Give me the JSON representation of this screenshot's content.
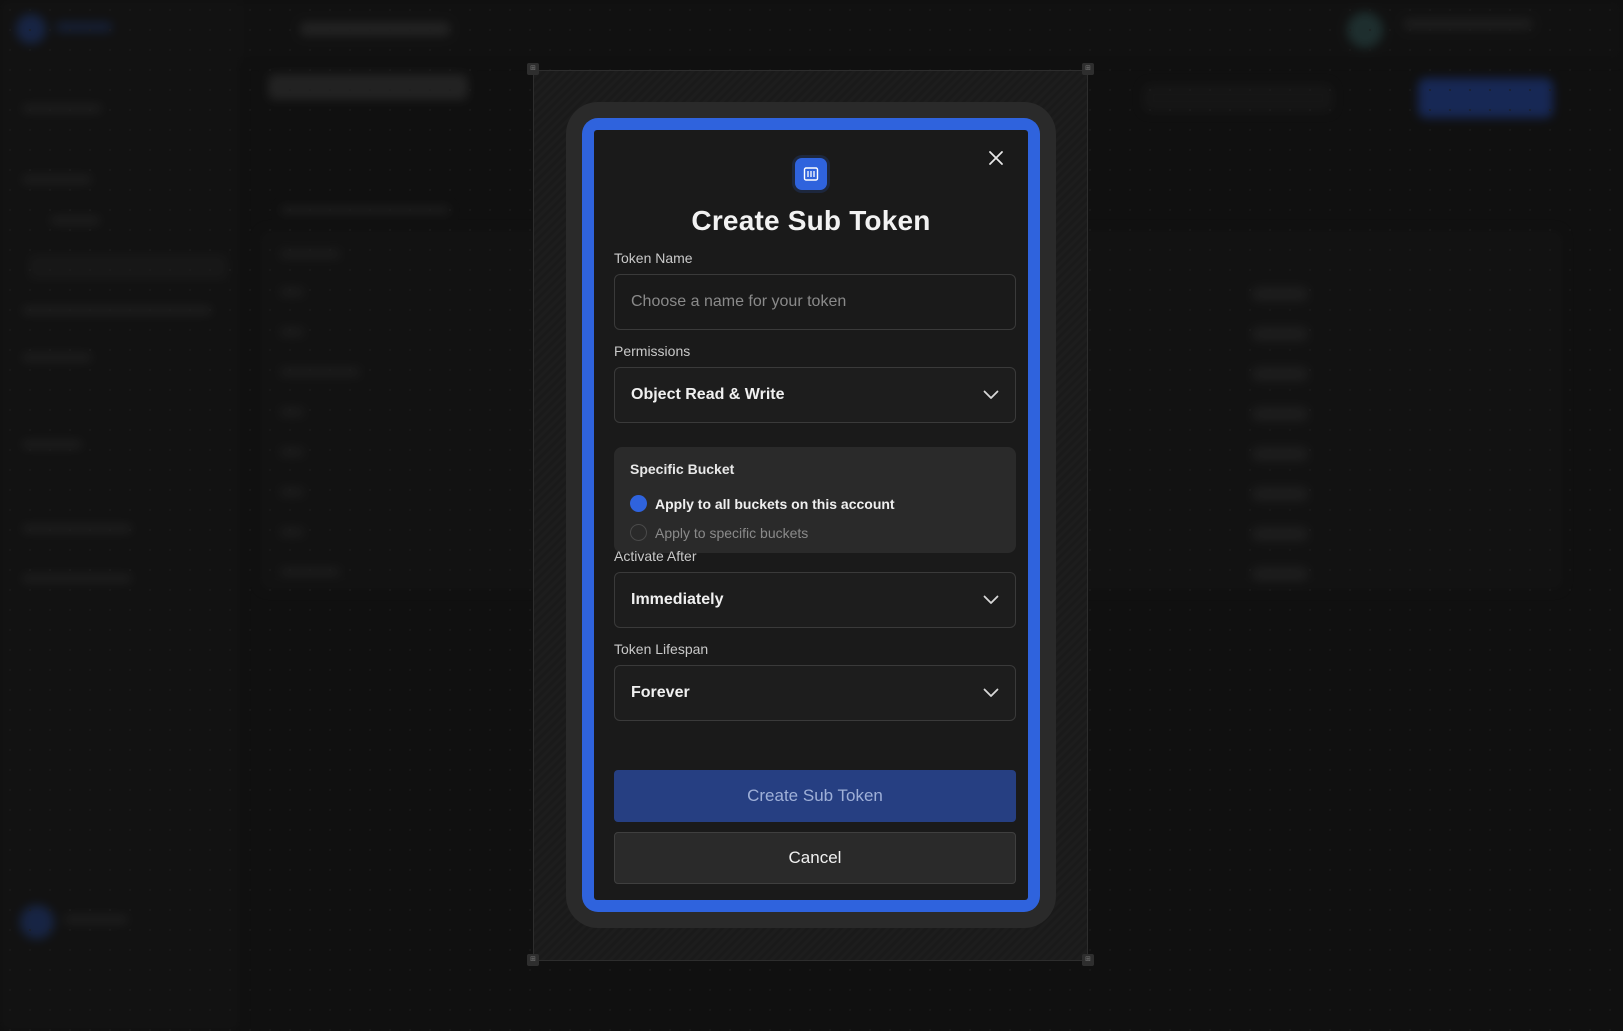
{
  "modal": {
    "title": "Create Sub Token",
    "app_icon": "bucket-grid-icon",
    "close_icon": "close-icon"
  },
  "form": {
    "token_name": {
      "label": "Token Name",
      "placeholder": "Choose a name for your token",
      "value": ""
    },
    "permissions": {
      "label": "Permissions",
      "value": "Object Read & Write"
    },
    "specific_bucket": {
      "title": "Specific Bucket",
      "options": [
        {
          "label": "Apply to all buckets on this account",
          "selected": true
        },
        {
          "label": "Apply to specific buckets",
          "selected": false
        }
      ]
    },
    "activate_after": {
      "label": "Activate After",
      "value": "Immediately"
    },
    "token_lifespan": {
      "label": "Token Lifespan",
      "value": "Forever"
    }
  },
  "actions": {
    "submit_label": "Create Sub Token",
    "cancel_label": "Cancel"
  },
  "colors": {
    "accent": "#2f63dd",
    "background": "#141414",
    "modal": "#1a1a1a"
  }
}
